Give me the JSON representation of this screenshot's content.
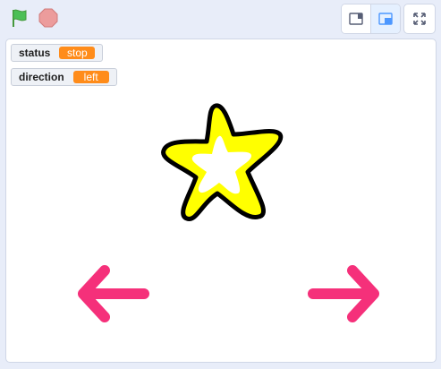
{
  "toolbar": {
    "green_flag_icon": "green-flag-icon",
    "stop_icon": "stop-sign-icon",
    "colors": {
      "flag": "#4cbf56",
      "stop": "#ec9c9c",
      "active_mode": "#4c97ff"
    }
  },
  "stage_modes": {
    "items": [
      {
        "icon": "small-stage-icon",
        "active": false
      },
      {
        "icon": "large-stage-icon",
        "active": true
      }
    ],
    "fullscreen_icon": "fullscreen-icon"
  },
  "monitors": [
    {
      "label": "status",
      "value": "stop"
    },
    {
      "label": "direction",
      "value": "left"
    }
  ],
  "sprites": {
    "star": {
      "icon": "star-icon",
      "fill": "#ffff00",
      "outline": "#000000"
    },
    "left_arrow": {
      "icon": "left-arrow-icon",
      "color": "#f5307a"
    },
    "right_arrow": {
      "icon": "right-arrow-icon",
      "color": "#f5307a"
    }
  },
  "colors": {
    "monitor_value": "#ff8c1a",
    "background": "#e8edf9"
  }
}
